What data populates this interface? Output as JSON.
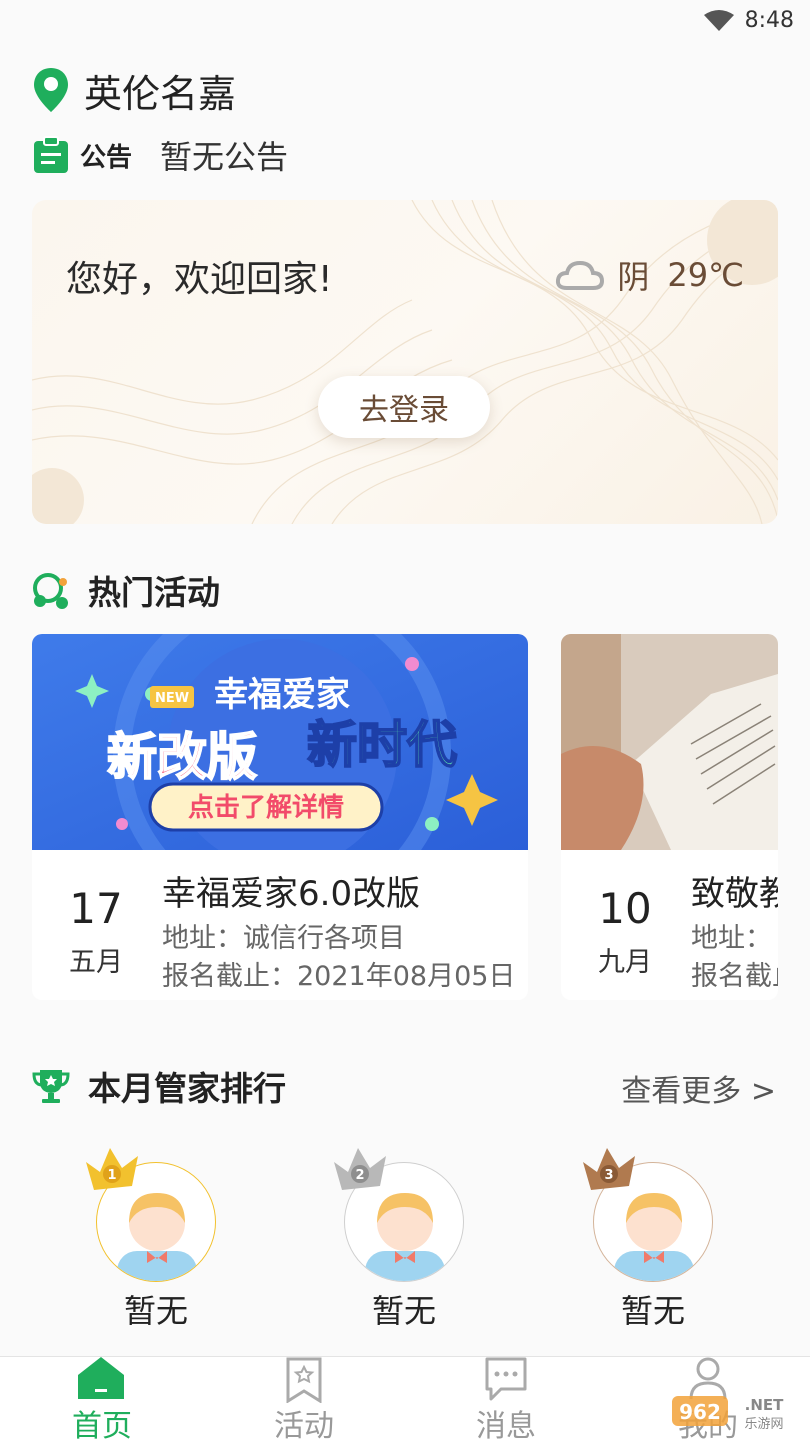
{
  "status_bar": {
    "time": "8:48"
  },
  "community": {
    "name": "英伦名嘉"
  },
  "notice": {
    "label": "公告",
    "text": "暂无公告"
  },
  "welcome": {
    "greeting": "您好，欢迎回家!",
    "weather": "阴",
    "temperature": "29℃",
    "login_label": "去登录"
  },
  "hot_activities": {
    "title": "热门活动",
    "cards": [
      {
        "banner_tag": "NEW",
        "banner_line1": "幸福爱家",
        "banner_line2a": "新改版",
        "banner_line2b": "新时代",
        "banner_cta": "点击了解详情",
        "day": "17",
        "month": "五月",
        "title": "幸福爱家6.0改版",
        "address": "地址：诚信行各项目",
        "deadline": "报名截止：2021年08月05日"
      },
      {
        "day": "10",
        "month": "九月",
        "title": "致敬教",
        "address": "地址：",
        "deadline": "报名截止"
      }
    ]
  },
  "ranking": {
    "title": "本月管家排行",
    "view_more": "查看更多 >",
    "items": [
      {
        "rank": "1",
        "name": "暂无",
        "color": "#f2c12e"
      },
      {
        "rank": "2",
        "name": "暂无",
        "color": "#a9a9a9"
      },
      {
        "rank": "3",
        "name": "暂无",
        "color": "#b07a4f"
      }
    ]
  },
  "tabbar": {
    "tabs": [
      {
        "label": "首页",
        "active": true
      },
      {
        "label": "活动"
      },
      {
        "label": "消息"
      },
      {
        "label": "我的"
      }
    ]
  },
  "watermark": "962.NET 乐游网",
  "colors": {
    "accent": "#1fae5c",
    "brown": "#6a4c36"
  }
}
